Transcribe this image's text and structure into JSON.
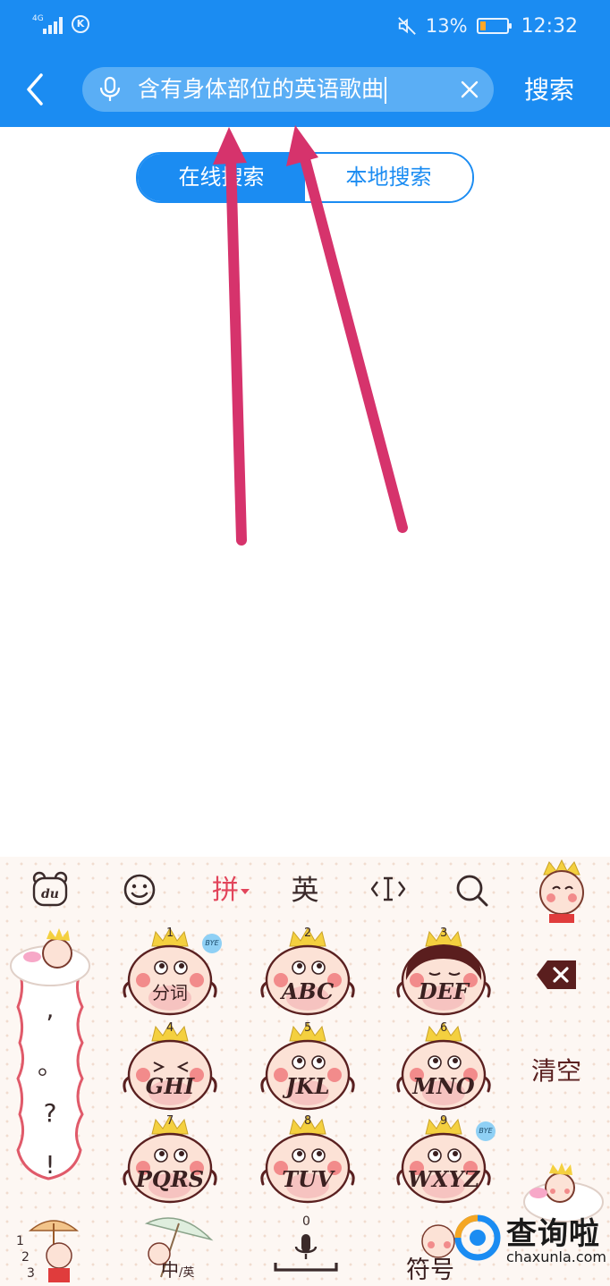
{
  "status_bar": {
    "network": "4G",
    "k_badge": "K",
    "battery_level": "13%",
    "time": "12:32",
    "icons": [
      "signal-icon",
      "k-badge-icon",
      "mute-icon",
      "battery-icon"
    ]
  },
  "header": {
    "query": "含有身体部位的英语歌曲",
    "search_button": "搜索",
    "colors": {
      "bar": "#1b8cf2",
      "field": "#5aaef5"
    }
  },
  "tabs": [
    {
      "label": "在线搜索",
      "selected": true
    },
    {
      "label": "本地搜索",
      "selected": false
    }
  ],
  "annotation": {
    "arrow_color": "#d6336c"
  },
  "keyboard": {
    "toolbar": {
      "du": "du",
      "pinyin": "拼",
      "english": "英"
    },
    "side_punct": [
      ",",
      "。",
      "?",
      "!"
    ],
    "keys": [
      {
        "num": "1",
        "label": "分词"
      },
      {
        "num": "2",
        "label": "ABC"
      },
      {
        "num": "3",
        "label": "DEF"
      },
      {
        "num": "4",
        "label": "GHI"
      },
      {
        "num": "5",
        "label": "JKL"
      },
      {
        "num": "6",
        "label": "MNO"
      },
      {
        "num": "7",
        "label": "PQRS"
      },
      {
        "num": "8",
        "label": "TUV"
      },
      {
        "num": "9",
        "label": "WXYZ"
      }
    ],
    "clear_label": "清空",
    "bottom": {
      "nums": [
        "1",
        "2",
        "3"
      ],
      "switch_main": "中",
      "switch_sub": "/英",
      "zero": "0",
      "symbol": "符号"
    },
    "bye_badge": "BYE"
  },
  "watermark": {
    "cn": "查询啦",
    "en": "chaxunla.com"
  }
}
